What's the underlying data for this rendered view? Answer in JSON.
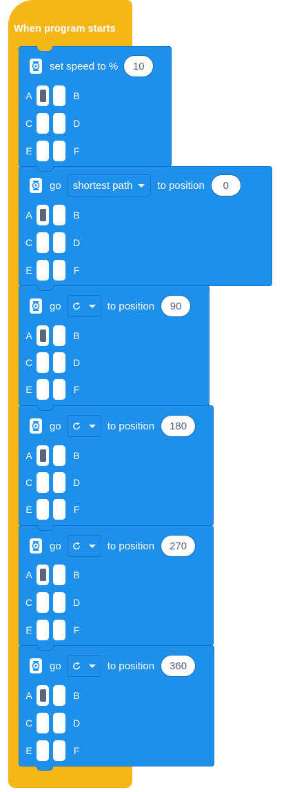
{
  "hat": {
    "label": "When program starts"
  },
  "set_speed": {
    "label": "set speed to %",
    "value": "10"
  },
  "ports": {
    "a": "A",
    "b": "B",
    "c": "C",
    "d": "D",
    "e": "E",
    "f": "F"
  },
  "go_blocks": [
    {
      "go": "go",
      "mode": "shortest path",
      "to_position": "to position",
      "value": "0"
    },
    {
      "go": "go",
      "mode": "clockwise",
      "to_position": "to position",
      "value": "90"
    },
    {
      "go": "go",
      "mode": "clockwise",
      "to_position": "to position",
      "value": "180"
    },
    {
      "go": "go",
      "mode": "clockwise",
      "to_position": "to position",
      "value": "270"
    },
    {
      "go": "go",
      "mode": "clockwise",
      "to_position": "to position",
      "value": "360"
    }
  ],
  "icons": {
    "motor": "motor-icon",
    "direction": "clockwise-icon",
    "dropdown": "caret-down-icon"
  },
  "colors": {
    "hat": "#f4b715",
    "block": "#1e8fea",
    "field_text": "#575e75",
    "selected_port": "#5b6574"
  }
}
